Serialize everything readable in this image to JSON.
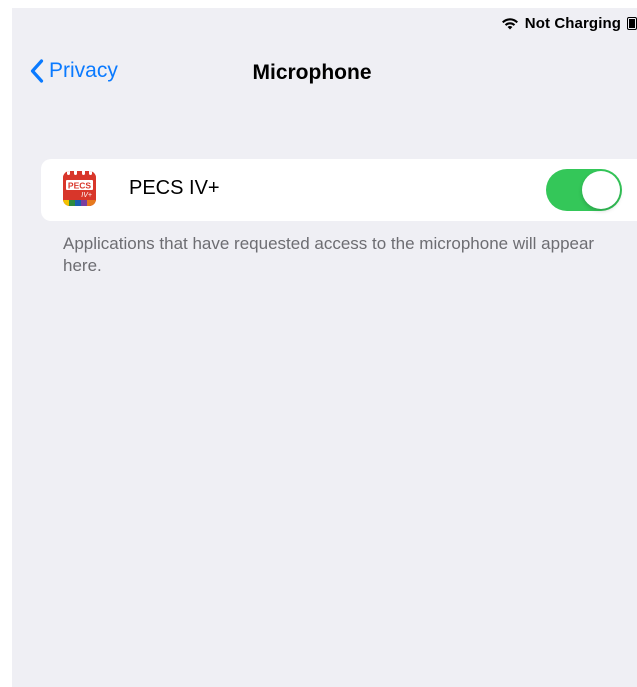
{
  "status_bar": {
    "wifi_icon": "wifi-icon",
    "battery_text": "Not Charging",
    "battery_icon": "battery-icon"
  },
  "nav": {
    "back_label": "Privacy",
    "back_icon": "chevron-left-icon",
    "title": "Microphone"
  },
  "apps": [
    {
      "name": "PECS IV+",
      "icon_label": "PECS",
      "icon_sub": "IV+",
      "microphone_access": true
    }
  ],
  "footer_note": "Applications that have requested access to the microphone will appear here.",
  "colors": {
    "accent": "#0a7aff",
    "toggle_on": "#34c759",
    "background": "#efeff4",
    "secondary_text": "#6d6d72"
  }
}
